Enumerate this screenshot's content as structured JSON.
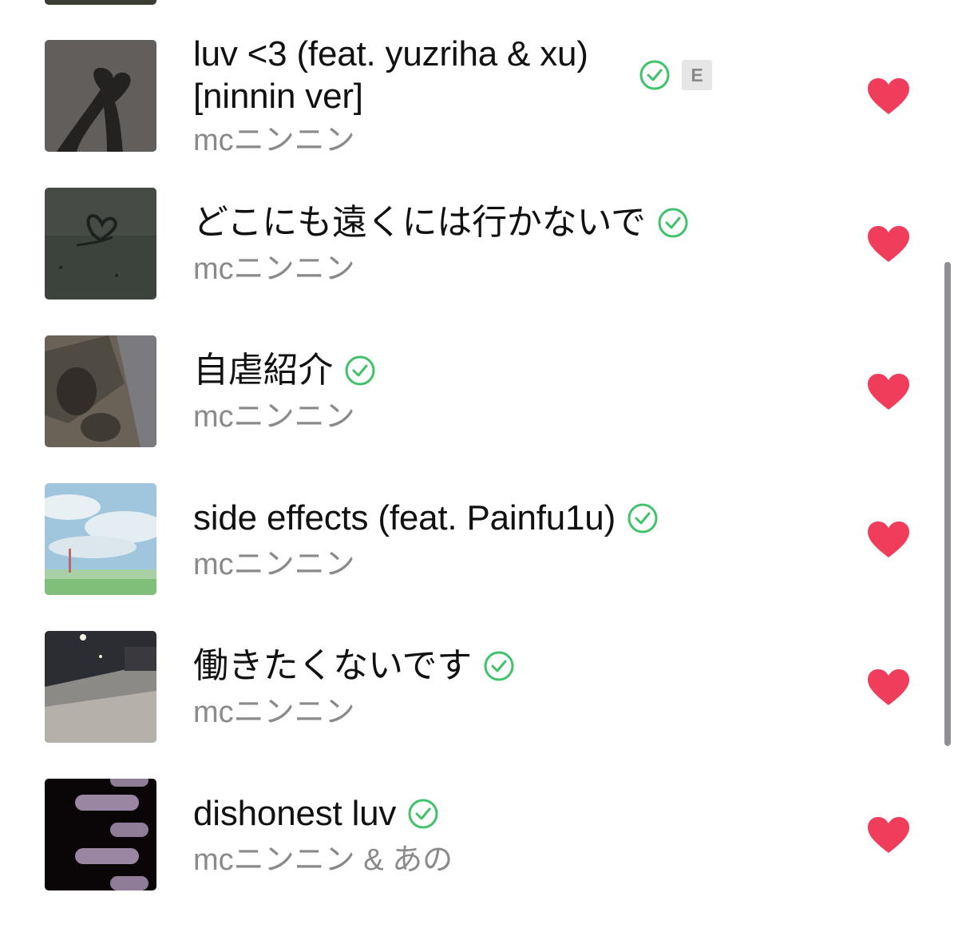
{
  "colors": {
    "heart": "#ef3d5b",
    "check": "#3fc26a",
    "title": "#111111",
    "artist": "#8a8a8a"
  },
  "tracks": [
    {
      "title_line1": "luv <3 (feat. yuzriha & xu)",
      "title_line2": "[ninnin ver]",
      "artist": "mcニンニン",
      "downloaded": true,
      "explicit": true,
      "explicit_label": "E",
      "liked": true,
      "artwork": "heart-hands-shadow"
    },
    {
      "title": "どこにも遠くには行かないで",
      "artist": "mcニンニン",
      "downloaded": true,
      "liked": true,
      "artwork": "heart-drawn-on-ground"
    },
    {
      "title": "自虐紹介",
      "artist": "mcニンニン",
      "downloaded": true,
      "liked": true,
      "artwork": "blurred-shadow"
    },
    {
      "title": "side effects (feat. Painfu1u)",
      "artist": "mcニンニン",
      "downloaded": true,
      "liked": true,
      "artwork": "sky-clouds"
    },
    {
      "title": "働きたくないです",
      "artist": "mcニンニン",
      "downloaded": true,
      "liked": true,
      "artwork": "snowy-night-street"
    },
    {
      "title": "dishonest luv",
      "artist": "mcニンニン & あの",
      "downloaded": true,
      "liked": true,
      "artwork": "chat-screenshot"
    }
  ]
}
